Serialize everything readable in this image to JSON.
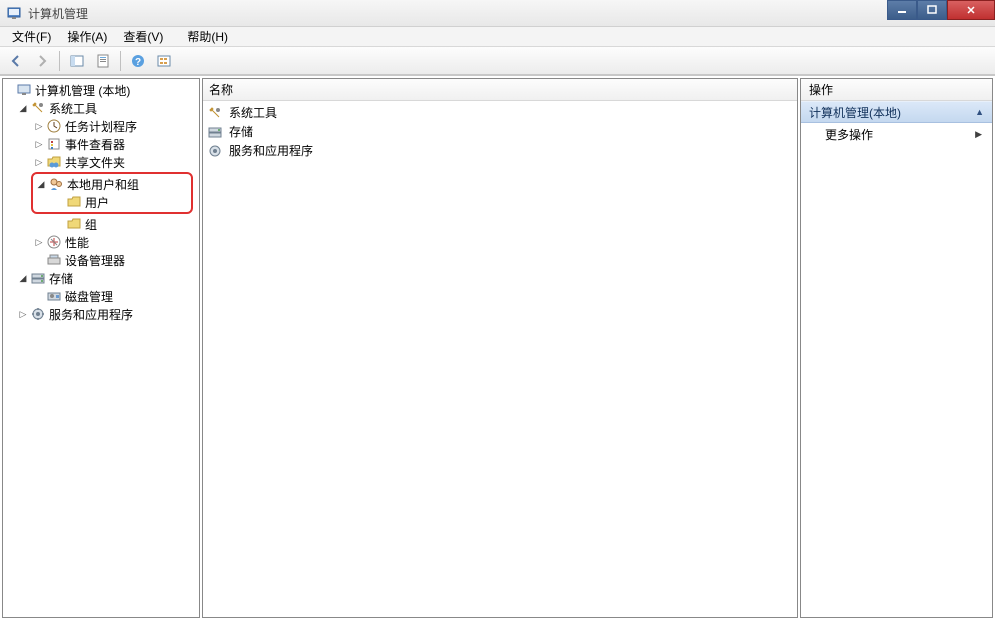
{
  "window": {
    "title": "计算机管理"
  },
  "menu": {
    "file": "文件(F)",
    "action": "操作(A)",
    "view": "查看(V)",
    "help": "帮助(H)"
  },
  "tree": {
    "root": "计算机管理 (本地)",
    "system_tools": "系统工具",
    "task_scheduler": "任务计划程序",
    "event_viewer": "事件查看器",
    "shared_folders": "共享文件夹",
    "local_users_groups": "本地用户和组",
    "users": "用户",
    "groups": "组",
    "performance": "性能",
    "device_manager": "设备管理器",
    "storage": "存储",
    "disk_management": "磁盘管理",
    "services_apps": "服务和应用程序"
  },
  "list": {
    "header_name": "名称",
    "items": {
      "system_tools": "系统工具",
      "storage": "存储",
      "services_apps": "服务和应用程序"
    }
  },
  "actions": {
    "header": "操作",
    "section_title": "计算机管理(本地)",
    "more_actions": "更多操作"
  }
}
